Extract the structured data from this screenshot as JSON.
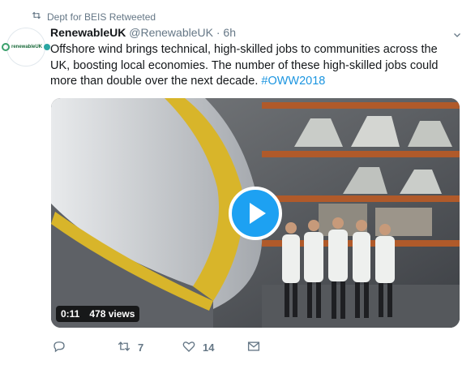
{
  "retweet": {
    "label": "Dept for BEIS Retweeted"
  },
  "tweet": {
    "avatar_text": "renewableUK",
    "name": "RenewableUK",
    "handle": "@RenewableUK",
    "separator": "·",
    "time": "6h",
    "text": "Offshore wind brings technical, high-skilled jobs to communities across the UK, boosting local economies. The number of these high-skilled jobs could more than double over the next decade.",
    "hashtag": "#OWW2018"
  },
  "video": {
    "duration": "0:11",
    "views": "478 views"
  },
  "actions": {
    "replies": "",
    "retweets": "7",
    "likes": "14"
  },
  "colors": {
    "accent": "#1da1f2",
    "link": "#1b95e0",
    "muted": "#657786"
  },
  "icons": [
    "retweet-icon",
    "chevron-down-icon",
    "reply-icon",
    "like-icon",
    "message-icon",
    "play-icon"
  ]
}
